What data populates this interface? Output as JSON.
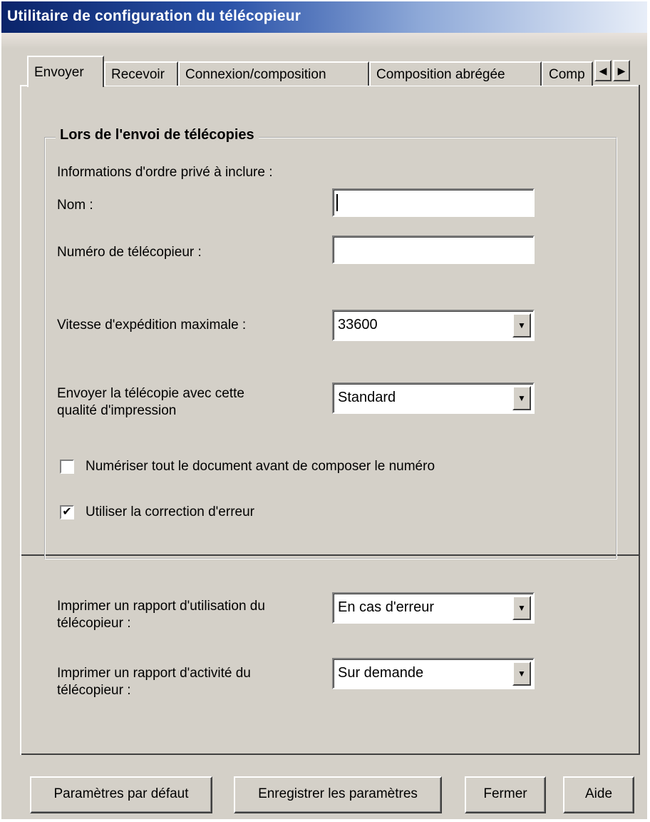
{
  "window": {
    "title": "Utilitaire de configuration du télécopieur"
  },
  "tabs": [
    {
      "label": "Envoyer",
      "active": true
    },
    {
      "label": "Recevoir",
      "active": false
    },
    {
      "label": "Connexion/composition",
      "active": false
    },
    {
      "label": "Composition abrégée",
      "active": false
    },
    {
      "label": "Comp",
      "active": false
    }
  ],
  "tab_scroll": {
    "left_icon": "triangle-left",
    "right_icon": "triangle-right",
    "left_glyph": "◀",
    "right_glyph": "▶"
  },
  "group": {
    "title": "Lors de l'envoi de télécopies",
    "private_info_label": "Informations d'ordre privé à inclure :",
    "name_label": "Nom :",
    "name_value": "",
    "fax_number_label": "Numéro de télécopieur :",
    "fax_number_value": "",
    "max_speed_label": "Vitesse d'expédition maximale :",
    "max_speed_value": "33600",
    "quality_label_line1": "Envoyer la télécopie avec cette",
    "quality_label_line2": "qualité d'impression",
    "quality_value": "Standard",
    "scan_checkbox_label": "Numériser tout le document avant de composer le numéro",
    "scan_checked": false,
    "ecm_checkbox_label": "Utiliser la correction d'erreur",
    "ecm_checked": true,
    "check_glyph": "✔"
  },
  "reports": {
    "usage_label_line1": "Imprimer un rapport d'utilisation du",
    "usage_label_line2": "télécopieur :",
    "usage_value": "En cas d'erreur",
    "activity_label_line1": "Imprimer un rapport d'activité du",
    "activity_label_line2": "télécopieur :",
    "activity_value": "Sur demande"
  },
  "dropdown_glyph": "▼",
  "buttons": {
    "defaults": "Paramètres par défaut",
    "save": "Enregistrer les paramètres",
    "close": "Fermer",
    "help": "Aide"
  },
  "colors": {
    "face": "#d4d0c8",
    "title_start": "#0a246a",
    "title_end": "#e8eef8"
  }
}
